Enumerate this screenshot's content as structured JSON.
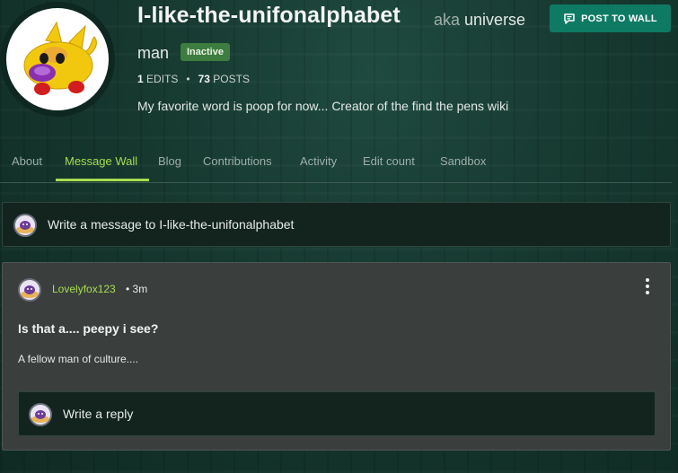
{
  "profile": {
    "username": "I-like-the-unifonalphabet",
    "aka_prefix": "aka",
    "aka_name_part1": "universe",
    "aka_name_part2": "man",
    "status_badge": "Inactive",
    "edits_count": "1",
    "edits_label": "EDITS",
    "posts_count": "73",
    "posts_label": "POSTS",
    "bio": "My favorite word is poop for now... Creator of the find the pens wiki",
    "post_to_wall_label": "POST TO WALL",
    "avatar_icon": "yellow-cat-creature"
  },
  "tabs": [
    {
      "label": "About"
    },
    {
      "label": "Message Wall",
      "active": true
    },
    {
      "label": "Blog"
    },
    {
      "label": "Contributions"
    },
    {
      "label": "Activity"
    },
    {
      "label": "Edit count"
    },
    {
      "label": "Sandbox"
    }
  ],
  "compose": {
    "placeholder": "Write a message to I-like-the-unifonalphabet"
  },
  "thread": {
    "author": "Lovelyfox123",
    "separator": "•",
    "time": "3m",
    "title": "Is that a.... peepy i see?",
    "body": "A fellow man of culture....",
    "reply_placeholder": "Write a reply"
  },
  "colors": {
    "accent_green": "#a7dd4f",
    "button_teal": "#0e7a64",
    "badge_green": "#3d7d3f",
    "background": "#16382f",
    "card": "#3a3f3e",
    "input": "#13241f"
  }
}
